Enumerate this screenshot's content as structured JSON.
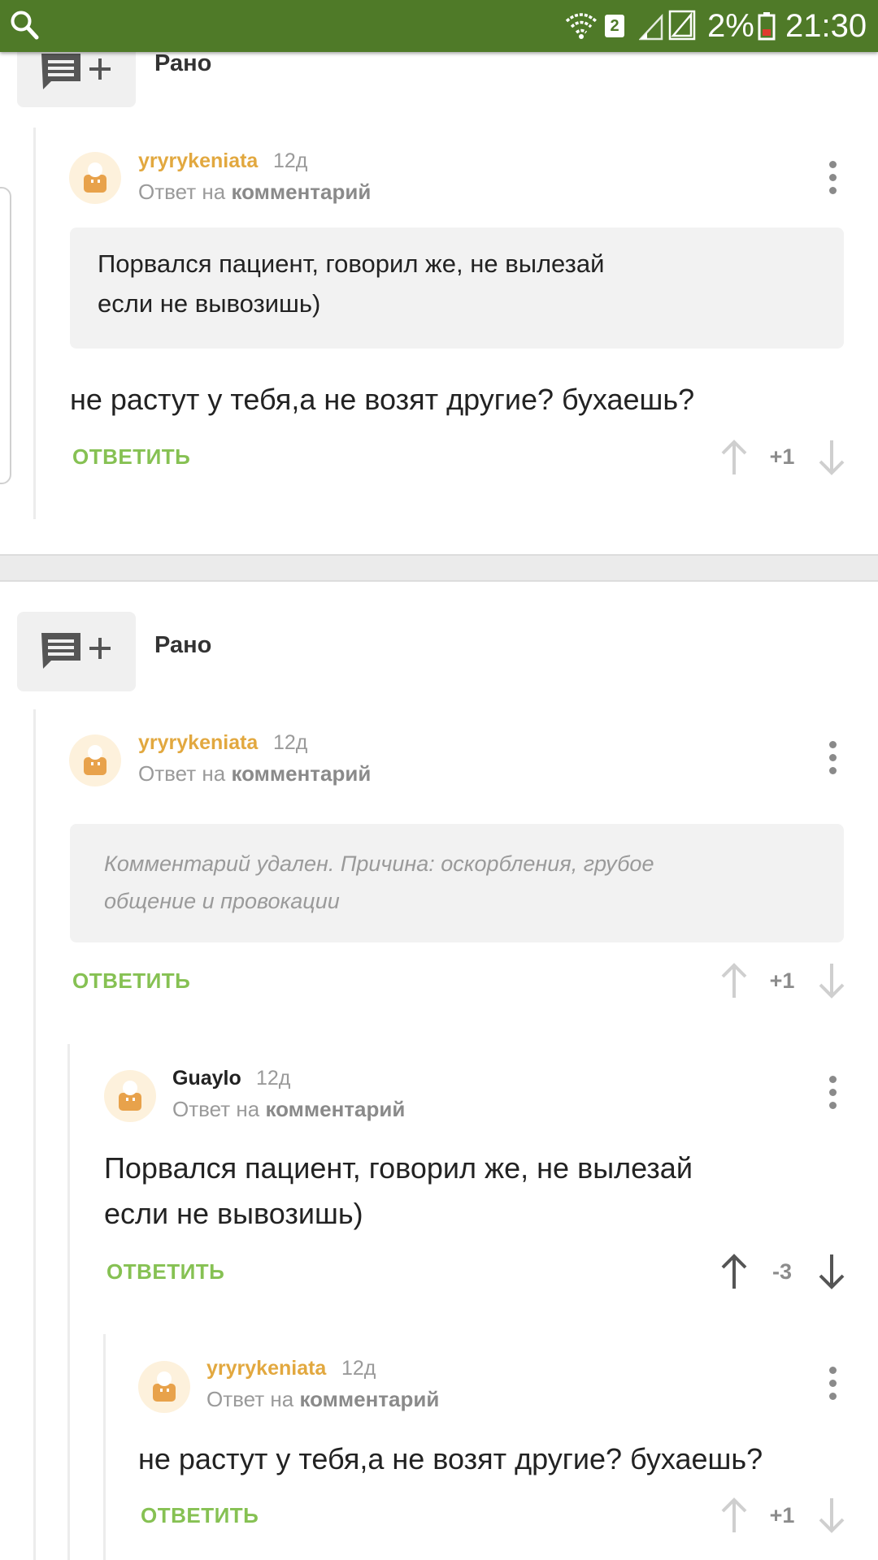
{
  "status_bar": {
    "sim": "2",
    "battery": "2%",
    "time": "21:30"
  },
  "blocks": [
    {
      "title": "Рано",
      "comment": {
        "author": "yryrykeniata",
        "age": "12д",
        "reply_prefix": "Ответ на",
        "reply_link": "комментарий",
        "quote": [
          "Порвался пациент, говорил же, не вылезай",
          "если не вывозишь)"
        ],
        "body": "не растут у тебя,а не возят другие? бухаешь?",
        "reply_label": "ОТВЕТИТЬ",
        "score": "+1"
      }
    },
    {
      "title": "Рано",
      "comment": {
        "author": "yryrykeniata",
        "age": "12д",
        "reply_prefix": "Ответ на",
        "reply_link": "комментарий",
        "deleted": [
          "Комментарий удален. Причина: оскорбления, грубое",
          "общение и провокации"
        ],
        "reply_label": "ОТВЕТИТЬ",
        "score": "+1"
      },
      "replies": [
        {
          "author": "Guaylo",
          "age": "12д",
          "reply_prefix": "Ответ на",
          "reply_link": "комментарий",
          "body": [
            "Порвался пациент, говорил же, не вылезай",
            "если не вывозишь)"
          ],
          "reply_label": "ОТВЕТИТЬ",
          "score": "-3"
        },
        {
          "author": "yryrykeniata",
          "age": "12д",
          "reply_prefix": "Ответ на",
          "reply_link": "комментарий",
          "body": "не растут у тебя,а не возят другие? бухаешь?",
          "reply_label": "ОТВЕТИТЬ",
          "score": "+1"
        }
      ]
    }
  ],
  "colors": {
    "status_bar": "#4f7a28",
    "author": "#e2a83f",
    "reply_action": "#86c153"
  }
}
